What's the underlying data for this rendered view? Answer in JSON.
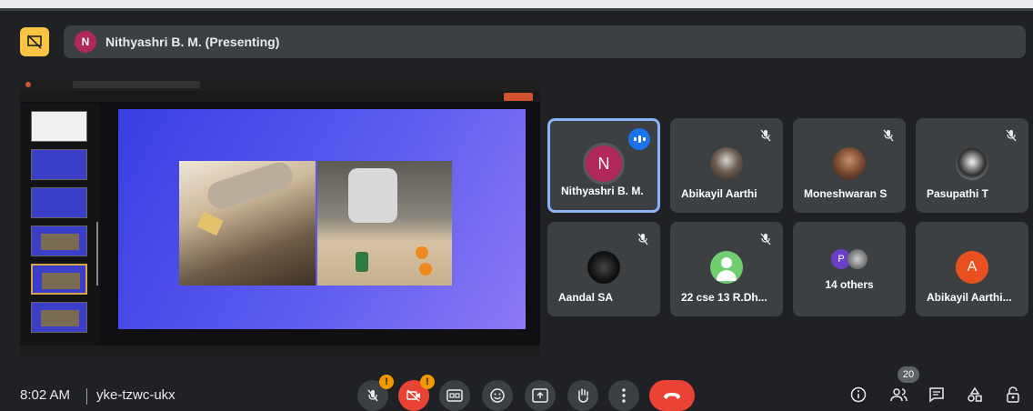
{
  "presenter": {
    "initial": "N",
    "label": "Nithyashri B. M. (Presenting)"
  },
  "tiles": [
    {
      "name": "Nithyashri B. M.",
      "initial": "N",
      "avatar_color": "#b0285a",
      "speaking": true
    },
    {
      "name": "Abikayil Aarthi",
      "muted": true
    },
    {
      "name": "Moneshwaran S",
      "muted": true
    },
    {
      "name": "Pasupathi T",
      "muted": true
    },
    {
      "name": "Aandal SA",
      "muted": true
    },
    {
      "name": "22 cse 13 R.Dh...",
      "muted": true
    },
    {
      "name": "14 others",
      "initial": "P"
    },
    {
      "name": "Abikayil Aarthi...",
      "initial": "A",
      "avatar_color": "#e8501f"
    }
  ],
  "bottom": {
    "time": "8:02 AM",
    "meeting_code": "yke-tzwc-ukx",
    "participant_count": "20"
  },
  "icons": [
    "present-icon",
    "mic-off-icon",
    "camera-off-icon",
    "captions-icon",
    "emoji-icon",
    "present-screen-icon",
    "raise-hand-icon",
    "more-options-icon",
    "end-call-icon",
    "info-icon",
    "people-icon",
    "chat-icon",
    "activities-icon",
    "host-controls-icon"
  ],
  "colors": {
    "background": "#202124",
    "tile": "#3c4043",
    "accent_blue": "#1a73e8",
    "active_border": "#8ab4f8",
    "end_call": "#ea4335",
    "present_badge": "#f9c443"
  }
}
